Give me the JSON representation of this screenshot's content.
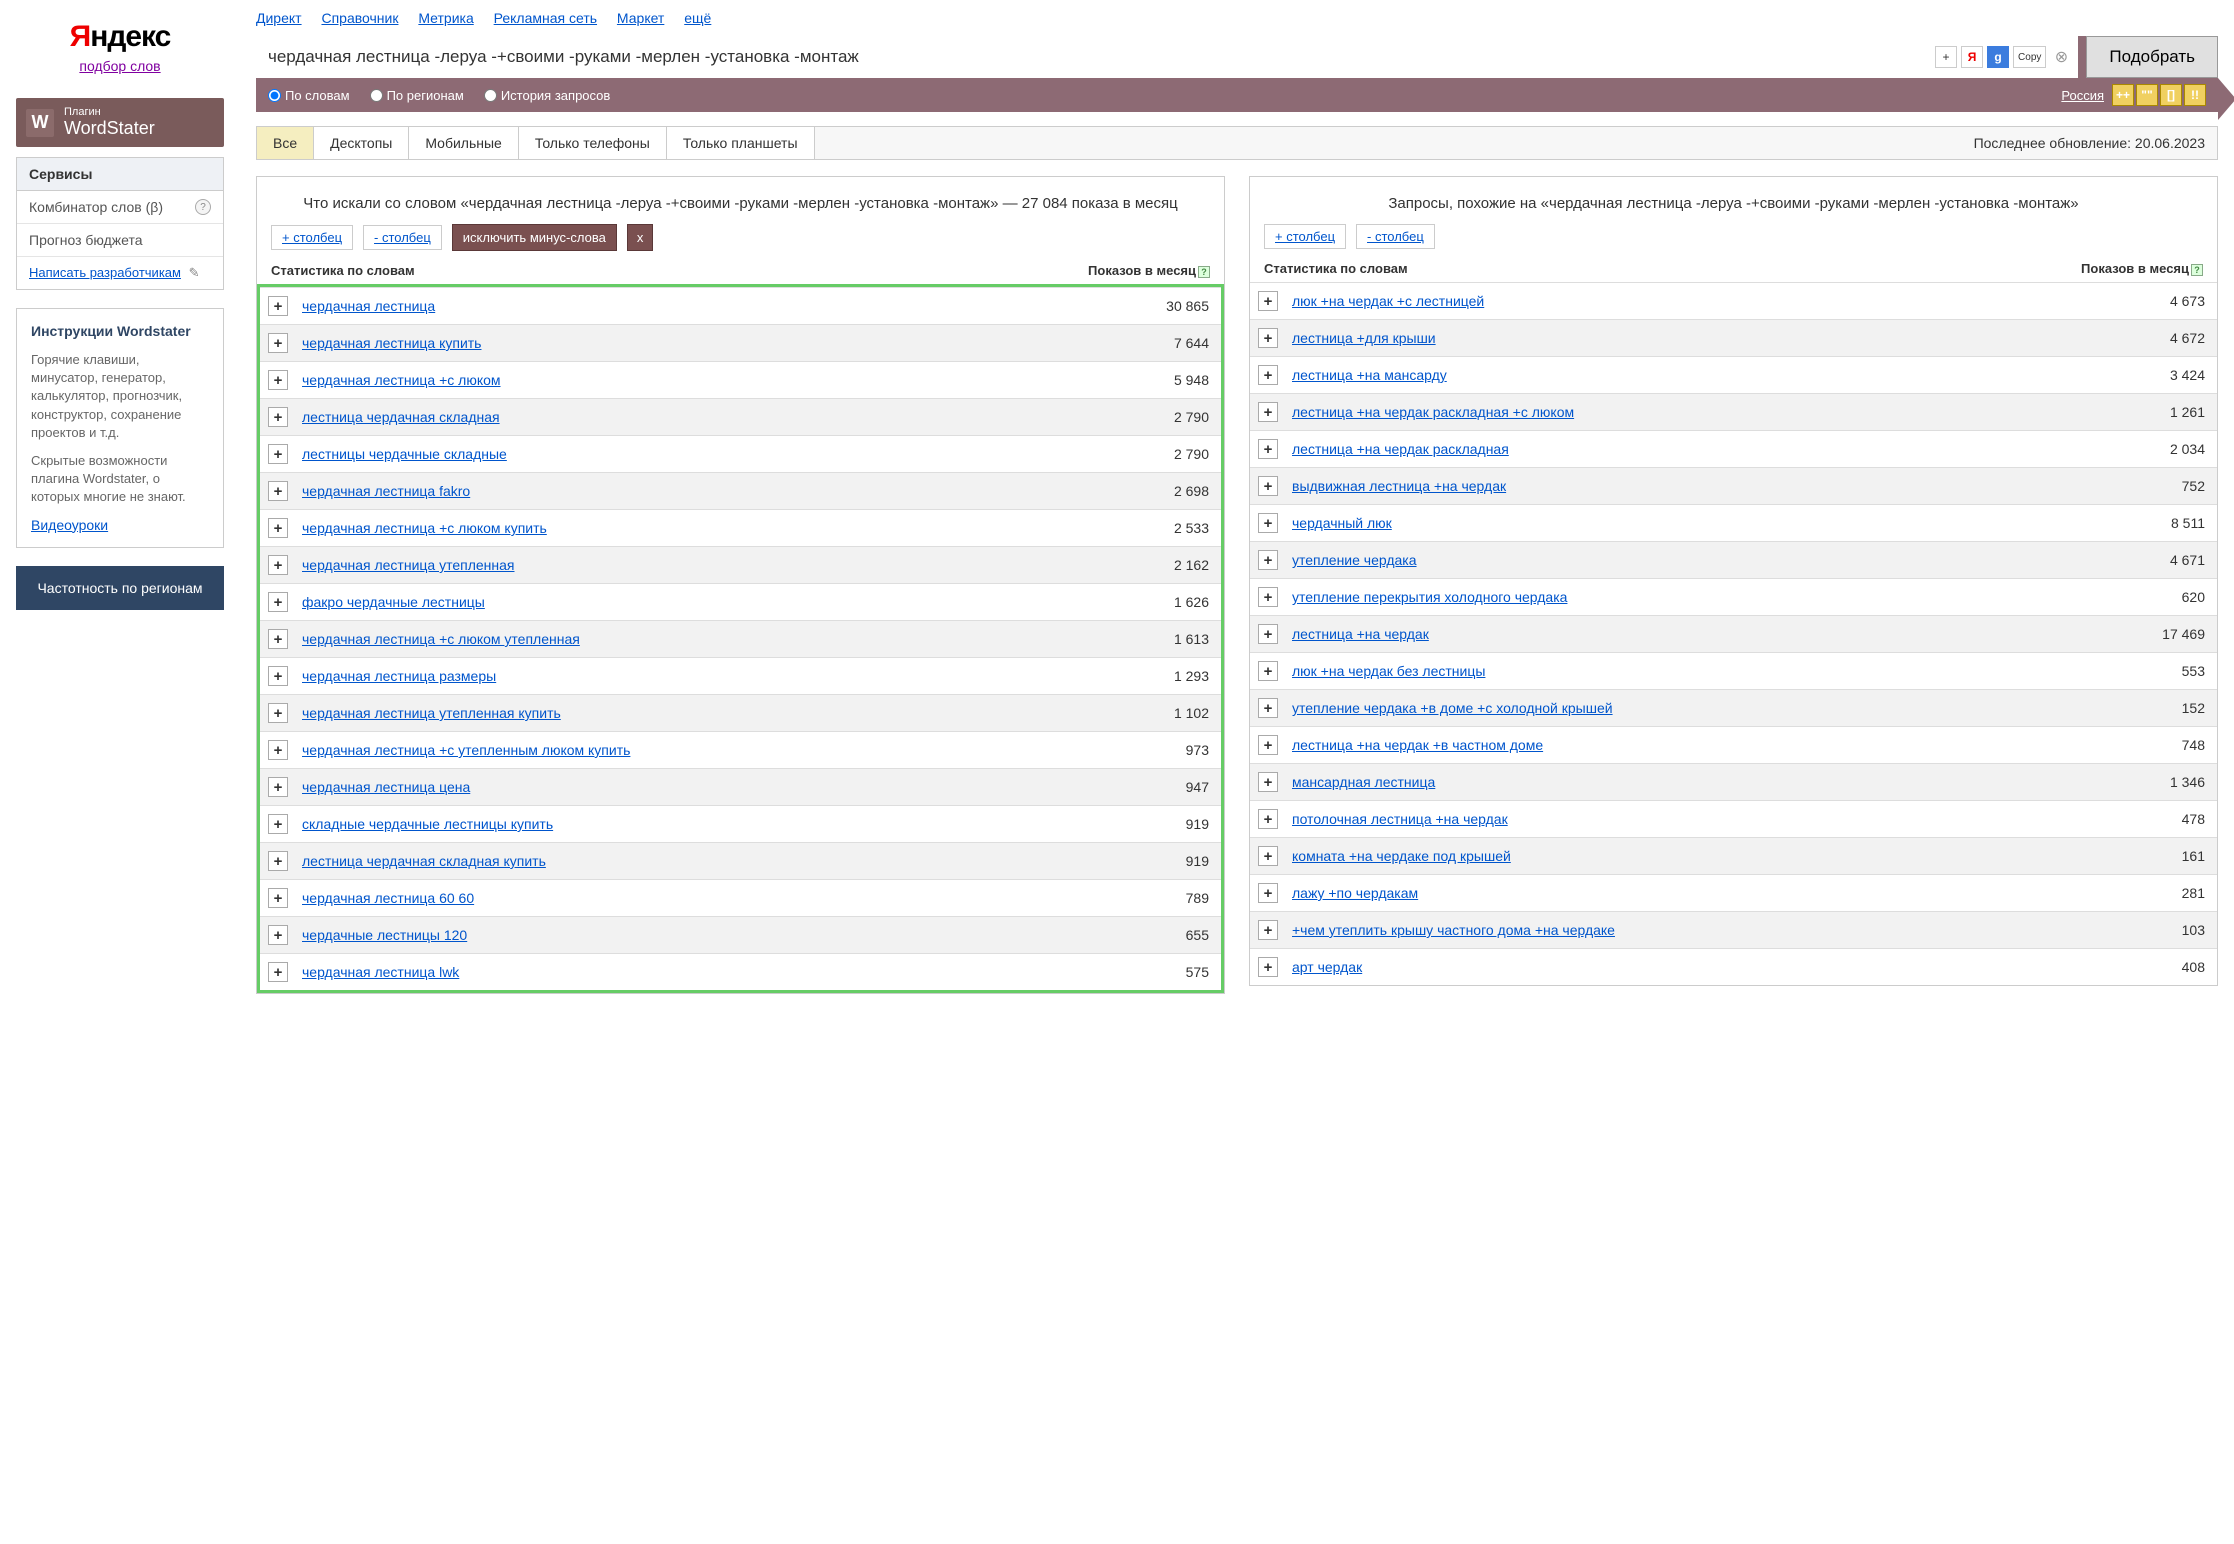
{
  "logo": {
    "y": "Я",
    "rest": "ндекс",
    "subtitle": "подбор слов"
  },
  "plugin": {
    "label": "Плагин",
    "name": "WordStater"
  },
  "sidebar": {
    "services_head": "Сервисы",
    "combinator": "Комбинатор слов (β)",
    "forecast": "Прогноз бюджета",
    "write_dev": "Написать разработчикам",
    "instr_head": "Инструкции Wordstater",
    "instr_body": "Горячие клавиши, минусатор, генератор, калькулятор, прогнозчик, конструктор, сохранение проектов и т.д.",
    "instr_body2": "Скрытые возможности плагина Wordstater, о которых многие не знают.",
    "video": "Видеоуроки",
    "region_btn": "Частотность по регионам"
  },
  "top_links": [
    "Директ",
    "Справочник",
    "Метрика",
    "Рекламная сеть",
    "Маркет",
    "ещё"
  ],
  "search": {
    "value": "чердачная лестница -леруа -+своими -руками -мерлен -установка -монтаж",
    "button": "Подобрать",
    "copy": "Copy",
    "radios": {
      "words": "По словам",
      "regions": "По регионам",
      "history": "История запросов"
    },
    "region": "Россия",
    "ext": [
      "++",
      "\"\"",
      "[]",
      "!!"
    ]
  },
  "tabs": [
    "Все",
    "Десктопы",
    "Мобильные",
    "Только телефоны",
    "Только планшеты"
  ],
  "update": "Последнее обновление: 20.06.2023",
  "left": {
    "title": "Что искали со словом «чердачная лестница -леруа -+своими -руками -мерлен -установка -монтаж» — 27 084 показа в месяц",
    "plus_col": "+ столбец",
    "minus_col": "- столбец",
    "exclude": "исключить минус-слова",
    "x": "x",
    "th1": "Статистика по словам",
    "th2": "Показов в месяц",
    "rows": [
      {
        "term": "чердачная лестница",
        "count": "30 865"
      },
      {
        "term": "чердачная лестница купить",
        "count": "7 644"
      },
      {
        "term": "чердачная лестница +с люком",
        "count": "5 948"
      },
      {
        "term": "лестница чердачная складная",
        "count": "2 790"
      },
      {
        "term": "лестницы чердачные складные",
        "count": "2 790"
      },
      {
        "term": "чердачная лестница fakro",
        "count": "2 698"
      },
      {
        "term": "чердачная лестница +с люком купить",
        "count": "2 533"
      },
      {
        "term": "чердачная лестница утепленная",
        "count": "2 162"
      },
      {
        "term": "факро чердачные лестницы",
        "count": "1 626"
      },
      {
        "term": "чердачная лестница +с люком утепленная",
        "count": "1 613"
      },
      {
        "term": "чердачная лестница размеры",
        "count": "1 293"
      },
      {
        "term": "чердачная лестница утепленная купить",
        "count": "1 102"
      },
      {
        "term": "чердачная лестница +с утепленным люком купить",
        "count": "973"
      },
      {
        "term": "чердачная лестница цена",
        "count": "947"
      },
      {
        "term": "складные чердачные лестницы купить",
        "count": "919"
      },
      {
        "term": "лестница чердачная складная купить",
        "count": "919"
      },
      {
        "term": "чердачная лестница 60 60",
        "count": "789"
      },
      {
        "term": "чердачные лестницы 120",
        "count": "655"
      },
      {
        "term": "чердачная лестница lwk",
        "count": "575"
      }
    ]
  },
  "right": {
    "title": "Запросы, похожие на «чердачная лестница -леруа -+своими -руками -мерлен -установка -монтаж»",
    "plus_col": "+ столбец",
    "minus_col": "- столбец",
    "th1": "Статистика по словам",
    "th2": "Показов в месяц",
    "rows": [
      {
        "term": "люк +на чердак +с лестницей",
        "count": "4 673"
      },
      {
        "term": "лестница +для крыши",
        "count": "4 672"
      },
      {
        "term": "лестница +на мансарду",
        "count": "3 424"
      },
      {
        "term": "лестница +на чердак раскладная +с люком",
        "count": "1 261"
      },
      {
        "term": "лестница +на чердак раскладная",
        "count": "2 034"
      },
      {
        "term": "выдвижная лестница +на чердак",
        "count": "752"
      },
      {
        "term": "чердачный люк",
        "count": "8 511"
      },
      {
        "term": "утепление чердака",
        "count": "4 671"
      },
      {
        "term": "утепление перекрытия холодного чердака",
        "count": "620"
      },
      {
        "term": "лестница +на чердак",
        "count": "17 469"
      },
      {
        "term": "люк +на чердак без лестницы",
        "count": "553"
      },
      {
        "term": "утепление чердака +в доме +с холодной крышей",
        "count": "152"
      },
      {
        "term": "лестница +на чердак +в частном доме",
        "count": "748"
      },
      {
        "term": "мансардная лестница",
        "count": "1 346"
      },
      {
        "term": "потолочная лестница +на чердак",
        "count": "478"
      },
      {
        "term": "комната +на чердаке под крышей",
        "count": "161"
      },
      {
        "term": "лажу +по чердакам",
        "count": "281"
      },
      {
        "term": "+чем утеплить крышу частного дома +на чердаке",
        "count": "103"
      },
      {
        "term": "арт чердак",
        "count": "408"
      }
    ]
  }
}
